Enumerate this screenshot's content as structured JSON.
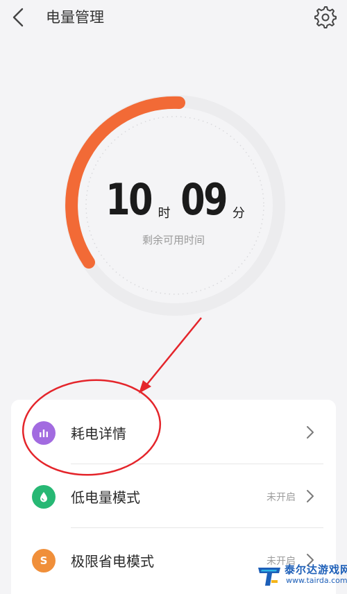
{
  "header": {
    "title": "电量管理"
  },
  "battery": {
    "hours": "10",
    "hours_unit": "时",
    "minutes": "09",
    "minutes_unit": "分",
    "caption": "剩余可用时间",
    "level_fraction": 0.32
  },
  "colors": {
    "accent": "#f26a36",
    "ring_track": "#ececee"
  },
  "menu": {
    "items": [
      {
        "label": "耗电详情",
        "status": "",
        "icon": "bar-chart-icon",
        "icon_color": "#a26be0"
      },
      {
        "label": "低电量模式",
        "status": "未开启",
        "icon": "water-drop-icon",
        "icon_color": "#27b874"
      },
      {
        "label": "极限省电模式",
        "status": "未开启",
        "icon": "s-letter-icon",
        "icon_glyph": "S",
        "icon_color": "#f08f3a"
      }
    ]
  },
  "watermark": {
    "name": "泰尔达游戏网",
    "url": "www.tairda.com"
  }
}
